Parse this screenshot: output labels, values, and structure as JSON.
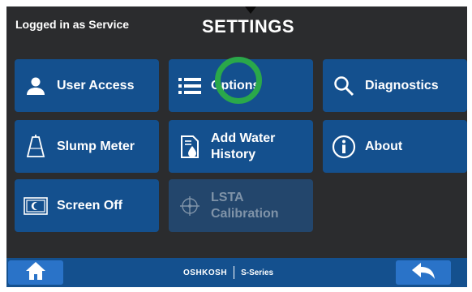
{
  "header": {
    "login_text": "Logged in as Service",
    "title": "SETTINGS"
  },
  "tiles": [
    {
      "label": "User Access",
      "icon": "user-icon",
      "enabled": true
    },
    {
      "label": "Options",
      "icon": "list-icon",
      "enabled": true
    },
    {
      "label": "Diagnostics",
      "icon": "magnifier-icon",
      "enabled": true
    },
    {
      "label": "Slump Meter",
      "icon": "slump-cone-icon",
      "enabled": true
    },
    {
      "label": "Add Water History",
      "icon": "water-document-icon",
      "enabled": true
    },
    {
      "label": "About",
      "icon": "info-icon",
      "enabled": true
    },
    {
      "label": "Screen Off",
      "icon": "screen-off-icon",
      "enabled": true
    },
    {
      "label": "LSTA Calibration",
      "icon": "crosshair-icon",
      "enabled": false
    }
  ],
  "footer": {
    "brand": "OSHKOSH",
    "series": "S-Series",
    "home_icon": "home-icon",
    "back_icon": "back-arrow-icon"
  },
  "colors": {
    "background": "#2b2c2e",
    "tile": "#14508e",
    "tile_disabled": "#23466c",
    "nav_button": "#2a73c8",
    "highlight_ring": "#2aa84a"
  }
}
